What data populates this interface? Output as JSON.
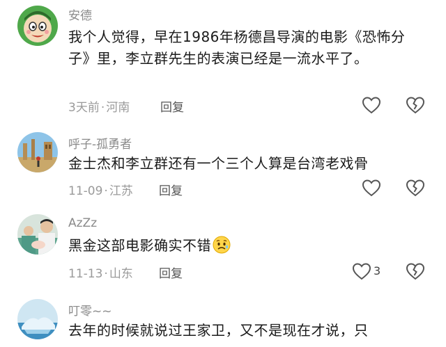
{
  "comments": [
    {
      "username": "安德",
      "content": "我个人觉得，早在1986年杨德昌导演的电影《恐怖分子》里，李立群先生的表演已经是一流水平了。",
      "time": "3天前",
      "location": "河南",
      "reply_label": "回复",
      "like_count": ""
    },
    {
      "username": "呼子-孤勇者",
      "content": "金士杰和李立群还有一个三个人算是台湾老戏骨",
      "time": "11-09",
      "location": "江苏",
      "reply_label": "回复",
      "like_count": ""
    },
    {
      "username": "AzZz",
      "content": "黑金这部电影确实不错",
      "time": "11-13",
      "location": "山东",
      "reply_label": "回复",
      "like_count": "3"
    },
    {
      "username": "叮零~~",
      "content": "去年的时候就说过王家卫，又不是现在才说，只",
      "time": "",
      "location": "",
      "reply_label": "",
      "like_count": ""
    }
  ],
  "separator": "·",
  "icons": {
    "like": "heart-outline-icon",
    "dislike": "broken-heart-icon",
    "emoji": "worried-face-emoji"
  },
  "colors": {
    "text": "#1a1a1a",
    "muted": "#9a9a9a",
    "icon": "#555555"
  }
}
